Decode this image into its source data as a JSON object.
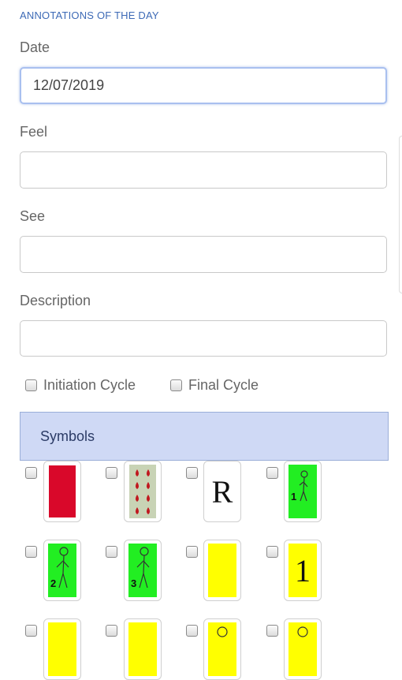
{
  "section_title": "ANNOTATIONS OF THE DAY",
  "fields": {
    "date": {
      "label": "Date",
      "value": "12/07/2019"
    },
    "feel": {
      "label": "Feel",
      "value": ""
    },
    "see": {
      "label": "See",
      "value": ""
    },
    "description": {
      "label": "Description",
      "value": ""
    }
  },
  "cycles": {
    "initiation": "Initiation Cycle",
    "final": "Final Cycle"
  },
  "symbols_header": "Symbols",
  "symbols": [
    {
      "name": "red-card",
      "color": "#d9082a"
    },
    {
      "name": "drops-card",
      "color": "#c8d3b5",
      "drop_color": "#c0181f"
    },
    {
      "name": "letter-card",
      "text": "R"
    },
    {
      "name": "figure-1-card",
      "color": "#22ee22",
      "tag": "1"
    },
    {
      "name": "figure-2-card",
      "color": "#22ee22",
      "tag": "2"
    },
    {
      "name": "figure-3-card",
      "color": "#22ee22",
      "tag": "3"
    },
    {
      "name": "yellow-card",
      "color": "#ffff00"
    },
    {
      "name": "number-card",
      "color": "#ffff00",
      "text": "1"
    }
  ]
}
